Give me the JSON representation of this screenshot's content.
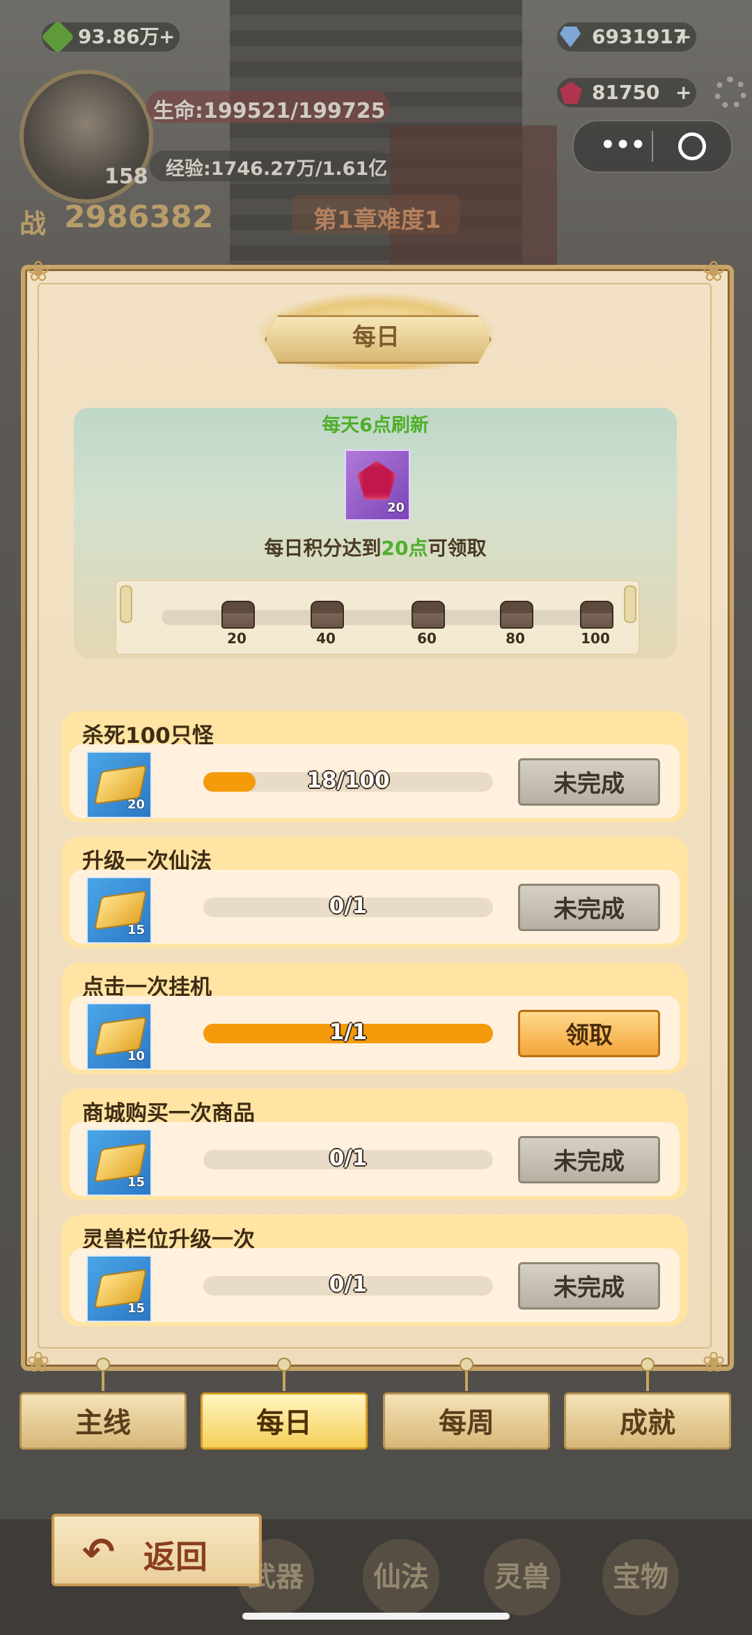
{
  "hud": {
    "jade": "93.86万",
    "diamond": "6931917",
    "ruby": "81750",
    "hp_text": "生命:199521/199725",
    "exp_text": "经验:1746.27万/1.61亿",
    "level": "158",
    "power_label": "战",
    "power": "2986382",
    "chapter": "第1章难度1",
    "plus": "+"
  },
  "dialog": {
    "title": "每日",
    "refresh_note": "每天6点刷新",
    "reward_count": "20",
    "claim_hint_pre": "每日积分达到",
    "claim_hint_points": "20点",
    "claim_hint_post": "可领取",
    "milestones": [
      "20",
      "40",
      "60",
      "80",
      "100"
    ],
    "daily_points_progress": 0
  },
  "tasks": [
    {
      "name": "杀死100只怪",
      "reward_count": "20",
      "progress_text": "18/100",
      "progress": 0.18,
      "button": "未完成",
      "state": "incomplete"
    },
    {
      "name": "升级一次仙法",
      "reward_count": "15",
      "progress_text": "0/1",
      "progress": 0,
      "button": "未完成",
      "state": "incomplete"
    },
    {
      "name": "点击一次挂机",
      "reward_count": "10",
      "progress_text": "1/1",
      "progress": 1,
      "button": "领取",
      "state": "claimable"
    },
    {
      "name": "商城购买一次商品",
      "reward_count": "15",
      "progress_text": "0/1",
      "progress": 0,
      "button": "未完成",
      "state": "incomplete"
    },
    {
      "name": "灵兽栏位升级一次",
      "reward_count": "15",
      "progress_text": "0/1",
      "progress": 0,
      "button": "未完成",
      "state": "incomplete"
    }
  ],
  "tabs": [
    "主线",
    "每日",
    "每周",
    "成就"
  ],
  "active_tab": "每日",
  "back_label": "返回",
  "bottom_nav": [
    "武器",
    "仙法",
    "灵兽",
    "宝物"
  ],
  "colors": {
    "accent_green": "#4fae2a",
    "claim_orange": "#f59a0b",
    "panel_beige": "#f2e1c4"
  },
  "icons": {
    "jade": "green-jade-icon",
    "diamond": "diamond-icon",
    "ruby": "ruby-icon",
    "settings": "gear-icon",
    "reward": "gold-ingot-icon",
    "milestone": "treasure-chest-icon",
    "back": "curved-arrow-icon"
  }
}
